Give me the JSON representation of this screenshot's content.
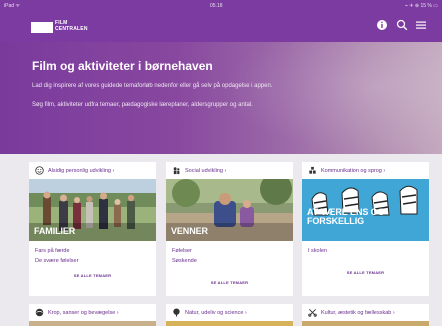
{
  "status_bar": {
    "left": "iPad ᯤ",
    "time": "05.18",
    "right": "⌁ ✈ ⊕ 15 % ▭"
  },
  "nav": {
    "logo_line1": "FILM",
    "logo_line2": "CENTRALEN",
    "icons": [
      "info-icon",
      "search-icon",
      "menu-icon"
    ]
  },
  "hero": {
    "title": "Film og aktiviteter i børnehaven",
    "line1": "Lad dig inspirere af vores guidede temaforløb nedenfor eller gå selv på opdagelse i appen.",
    "line2": "Søg film, aktiviteter udfra temaer, pædagogiske læreplaner, aldersgrupper og antal."
  },
  "cards": [
    {
      "title": "Alsidig personlig udvikling",
      "caption": "FAMILIER",
      "links": [
        "Fars på færde",
        "De svære følelser"
      ],
      "see_all": "SE ALLE TEMAER"
    },
    {
      "title": "Social udvikling",
      "caption": "VENNER",
      "links": [
        "Følelser",
        "Søskende"
      ],
      "see_all": "SE ALLE TEMAER"
    },
    {
      "title": "Kommunikation og sprog",
      "caption": "AT VÆRE ENS OG FORSKELLIG",
      "links": [
        "I skolen"
      ],
      "see_all": "SE ALLE TEMAER"
    },
    {
      "title": "Krop, sanser og bevægelse"
    },
    {
      "title": "Natur, udeliv og science"
    },
    {
      "title": "Kultur, æstetik og fællesskab"
    }
  ],
  "colors": {
    "brand": "#7c3ba1",
    "link": "#6a2f8f"
  }
}
